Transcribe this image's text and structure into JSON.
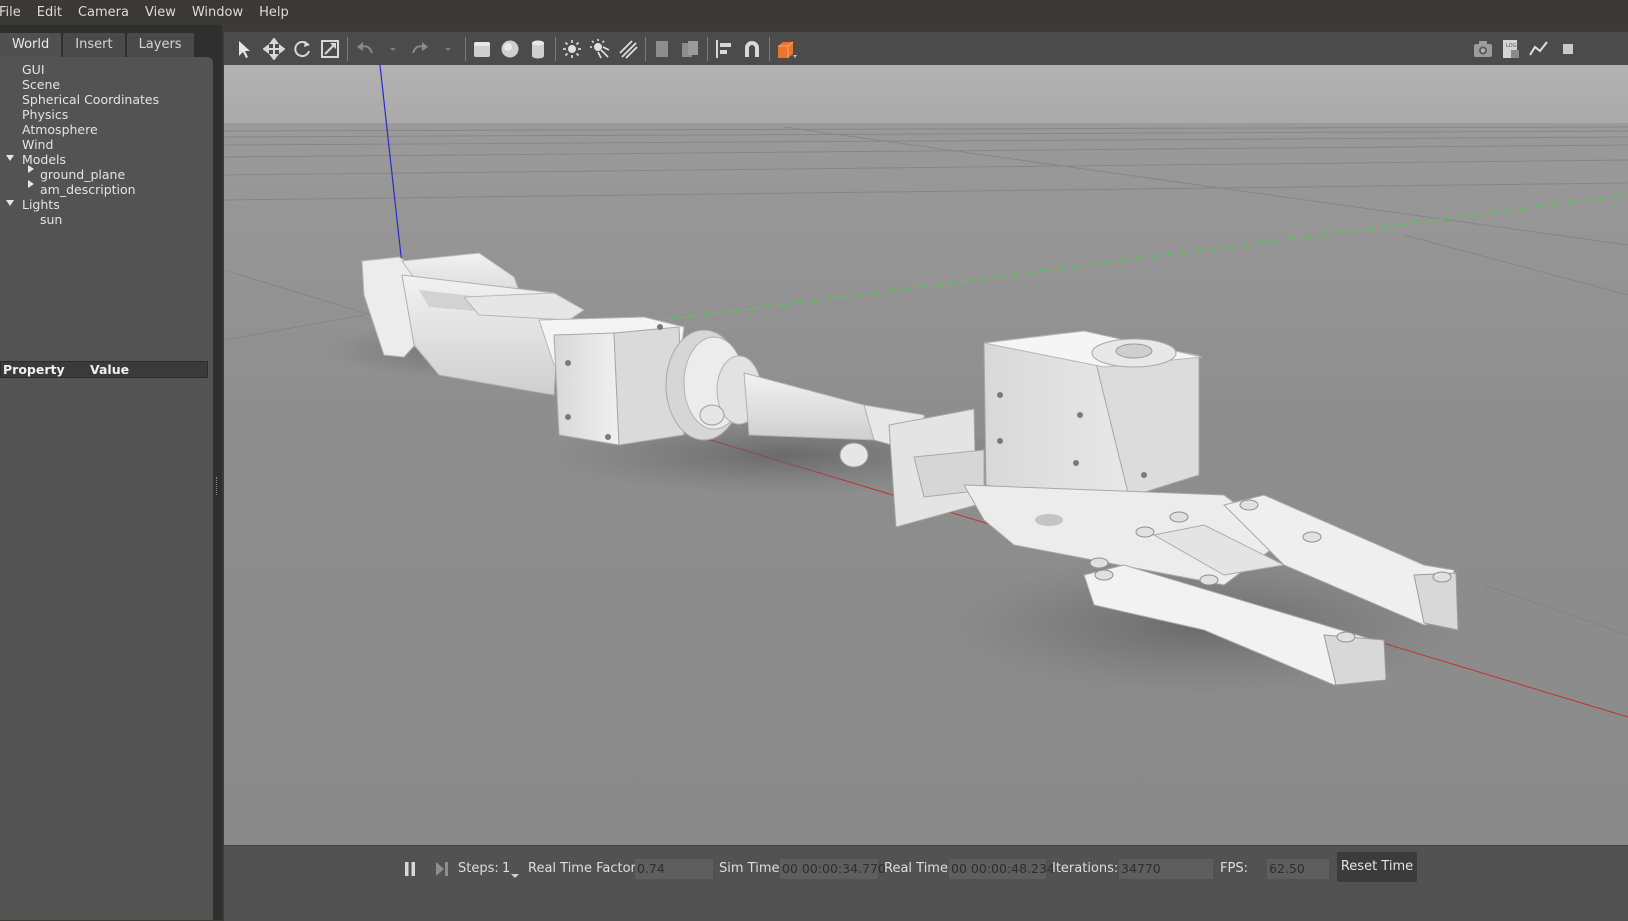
{
  "menu": [
    "File",
    "Edit",
    "Camera",
    "View",
    "Window",
    "Help"
  ],
  "tabs": [
    "World",
    "Insert",
    "Layers"
  ],
  "tree": {
    "gui": "GUI",
    "scene": "Scene",
    "spherical": "Spherical Coordinates",
    "physics": "Physics",
    "atmosphere": "Atmosphere",
    "wind": "Wind",
    "models": "Models",
    "ground_plane": "ground_plane",
    "am_description": "am_description",
    "lights": "Lights",
    "sun": "sun"
  },
  "property_header": {
    "property": "Property",
    "value": "Value"
  },
  "toolbar": {
    "left_icons": [
      "select-arrow-icon",
      "translate-icon",
      "rotate-icon",
      "scale-icon",
      "undo-icon",
      "redo-icon",
      "box-icon",
      "sphere-icon",
      "cylinder-icon",
      "point-light-icon",
      "spot-light-icon",
      "directional-light-icon",
      "copy-icon",
      "paste-icon",
      "align-icon",
      "snap-magnet-icon",
      "view-angle-icon"
    ],
    "right_icons": [
      "screenshot-camera-icon",
      "log-icon",
      "plot-icon",
      "video-record-icon"
    ]
  },
  "status": {
    "steps_label": "Steps:",
    "steps_value": "1",
    "rtf_label": "Real Time Factor:",
    "rtf_value": "0.74",
    "sim_label": "Sim Time:",
    "sim_value": "00 00:00:34.770",
    "real_label": "Real Time:",
    "real_value": "00 00:00:48.234",
    "iter_label": "Iterations:",
    "iter_value": "34770",
    "fps_label": "FPS:",
    "fps_value": "62.50",
    "reset_label": "Reset Time"
  },
  "colors": {
    "ground": "#8c8c8c",
    "sky": "#b5b5b5",
    "x_axis": "#c23030",
    "y_axis": "#40b040",
    "z_axis": "#2a2ad0",
    "model": "#e6e6e6",
    "accent_orange": "#e8762c"
  }
}
